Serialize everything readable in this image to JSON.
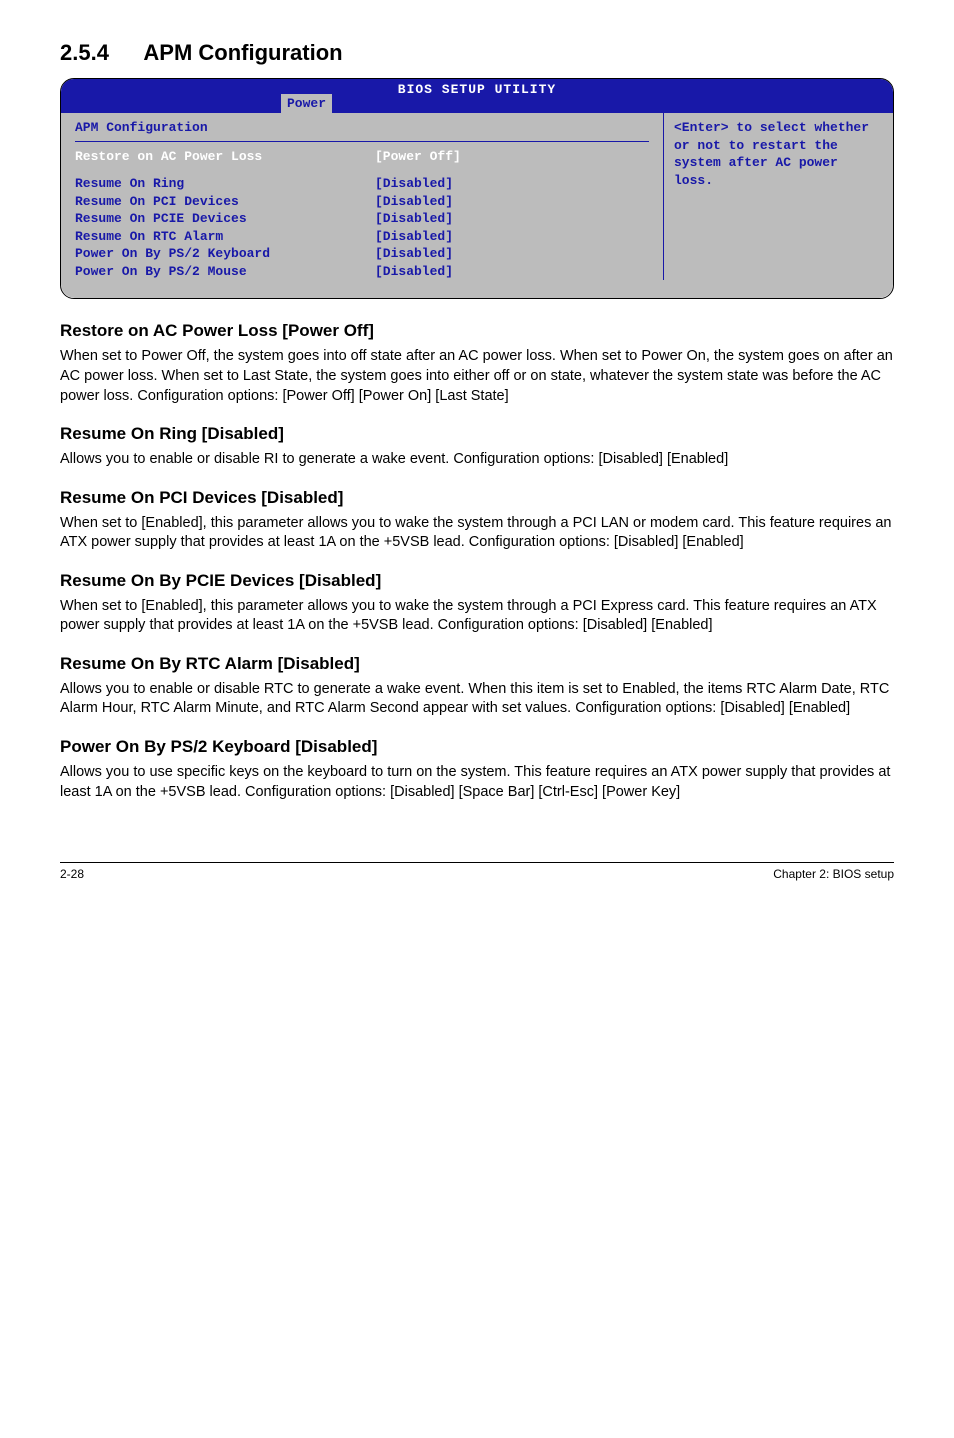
{
  "section": {
    "number": "2.5.4",
    "title": "APM Configuration"
  },
  "bios": {
    "header_title": "BIOS SETUP UTILITY",
    "tab": "Power",
    "left_heading": "APM Configuration",
    "rows": [
      {
        "label": "Restore on AC Power Loss",
        "value": "[Power Off]",
        "selected": true
      },
      {
        "label": "Resume On Ring",
        "value": "[Disabled]"
      },
      {
        "label": "Resume On PCI Devices",
        "value": "[Disabled]"
      },
      {
        "label": "Resume On PCIE Devices",
        "value": "[Disabled]"
      },
      {
        "label": "Resume On RTC Alarm",
        "value": "[Disabled]"
      },
      {
        "label": "Power On By PS/2 Keyboard",
        "value": "[Disabled]"
      },
      {
        "label": "Power On By PS/2 Mouse",
        "value": "[Disabled]"
      }
    ],
    "help": "<Enter> to select whether or not to restart the system after AC power loss."
  },
  "subsections": [
    {
      "title": "Restore on AC Power Loss [Power Off]",
      "body": "When set to Power Off, the system goes into off state after an AC power loss. When set to Power On, the system goes on after an AC power loss. When set to Last State, the system goes into either off or on state, whatever the system state was before the AC power loss. Configuration options: [Power Off] [Power On] [Last State]"
    },
    {
      "title": "Resume On Ring [Disabled]",
      "body": "Allows you to enable or disable RI to generate a wake event. Configuration options: [Disabled] [Enabled]"
    },
    {
      "title": "Resume On PCI Devices [Disabled]",
      "body": "When set to [Enabled], this parameter allows you to wake the system through a PCI LAN or modem card. This feature requires an ATX power supply that provides at least 1A on the +5VSB lead. Configuration options: [Disabled] [Enabled]"
    },
    {
      "title": "Resume On By PCIE Devices [Disabled]",
      "body": "When set to [Enabled], this parameter allows you to wake the system through a PCI Express card. This feature requires an ATX power supply that provides at least 1A on the +5VSB lead.  Configuration options: [Disabled] [Enabled]"
    },
    {
      "title": "Resume On By RTC Alarm [Disabled]",
      "body": "Allows you to enable or disable RTC to generate a wake event. When this item is set to Enabled, the items RTC Alarm Date, RTC Alarm Hour, RTC Alarm Minute, and RTC Alarm Second appear with set values. Configuration options: [Disabled] [Enabled]"
    },
    {
      "title": "Power On By PS/2 Keyboard [Disabled]",
      "body": "Allows you to use specific keys on the keyboard to turn on the system. This feature requires an ATX power supply that provides at least 1A on the +5VSB lead. Configuration options: [Disabled] [Space Bar] [Ctrl-Esc] [Power Key]"
    }
  ],
  "footer": {
    "left": "2-28",
    "right": "Chapter 2: BIOS setup"
  }
}
